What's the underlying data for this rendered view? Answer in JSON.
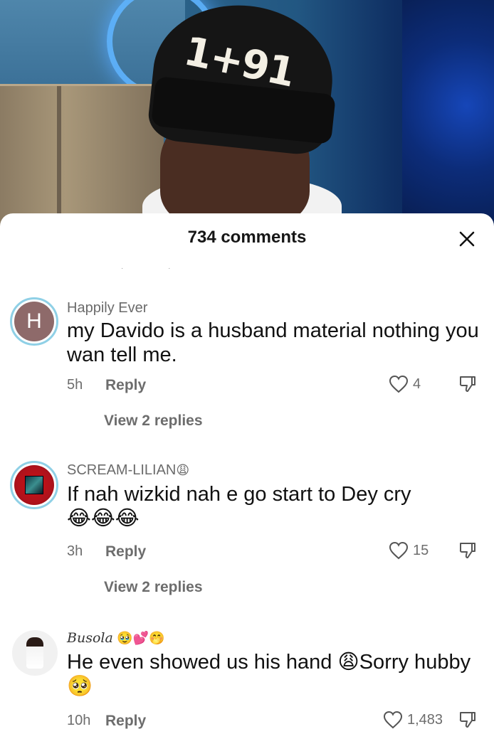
{
  "video": {
    "beanie_text": "1+91"
  },
  "sheet": {
    "title": "734 comments",
    "close_icon": "close-icon"
  },
  "comments": [
    {
      "avatar_letter": "H",
      "username": "Happily Ever",
      "text": "my Davido is a husband material nothing you wan tell me.",
      "time": "5h",
      "reply_label": "Reply",
      "likes": "4",
      "view_replies": "View 2 replies"
    },
    {
      "username": "SCREAM-LILIAN",
      "username_emoji": "😩",
      "text": "If nah wizkid nah e go start to Dey cry",
      "text_emoji": "😂😂😂",
      "time": "3h",
      "reply_label": "Reply",
      "likes": "15",
      "view_replies": "View 2 replies"
    },
    {
      "username": "Busola",
      "username_emoji": "🥹💕🤭",
      "text": "He even showed us his hand",
      "text_emoji_1": "😩",
      "text_after": "Sorry hubby",
      "text_emoji_2": "🥺",
      "time": "10h",
      "reply_label": "Reply",
      "likes": "1,483"
    }
  ],
  "colors": {
    "avatar_ring": "#8fd0e6",
    "text_primary": "#111111",
    "text_secondary": "#6d6d6d"
  }
}
